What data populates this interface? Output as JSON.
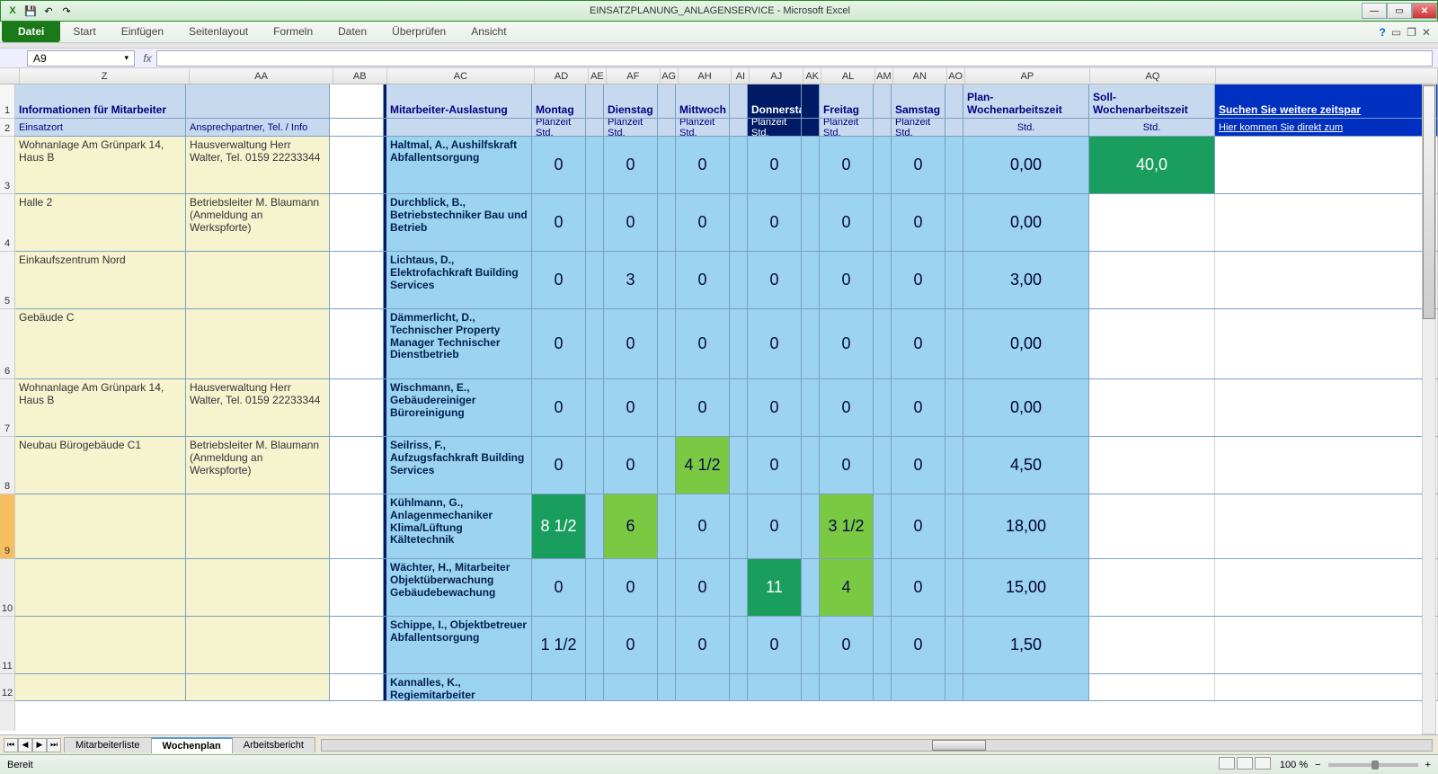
{
  "app": {
    "title": "EINSATZPLANUNG_ANLAGENSERVICE - Microsoft Excel"
  },
  "ribbon": {
    "file": "Datei",
    "tabs": [
      "Start",
      "Einfügen",
      "Seitenlayout",
      "Formeln",
      "Daten",
      "Überprüfen",
      "Ansicht"
    ]
  },
  "namebox": "A9",
  "columns": [
    "Z",
    "AA",
    "AB",
    "AC",
    "AD",
    "AE",
    "AF",
    "AG",
    "AH",
    "AI",
    "AJ",
    "AK",
    "AL",
    "AM",
    "AN",
    "AO",
    "AP",
    "AQ"
  ],
  "header1": {
    "z": "Informationen für Mitarbeiter",
    "ac": "Mitarbeiter-Auslastung",
    "days": [
      "Montag",
      "Dienstag",
      "Mittwoch",
      "Donnerstag",
      "Freitag",
      "Samstag"
    ],
    "ap": "Plan-Wochenarbeitszeit",
    "aq": "Soll-Wochenarbeitszeit",
    "ar": "Suchen Sie weitere zeitspar"
  },
  "header2": {
    "z": "Einsatzort",
    "aa": "Ansprechpartner, Tel. / Info",
    "pz": "Planzeit Std.",
    "std": "Std.",
    "ar": "Hier kommen Sie direkt zum"
  },
  "rows": [
    {
      "n": "3",
      "z": "Wohnanlage Am Grünpark 14, Haus B",
      "aa": "Hausverwaltung Herr Walter, Tel. 0159 22233344",
      "ac": "Haltmal, A., Aushilfskraft Abfallentsorgung",
      "d": [
        "0",
        "0",
        "0",
        "0",
        "0",
        "0"
      ],
      "ap": "0,00",
      "aq": "40,0",
      "hl": []
    },
    {
      "n": "4",
      "z": "Halle 2",
      "aa": "Betriebsleiter M. Blaumann (Anmeldung an Werkspforte)",
      "ac": "Durchblick, B., Betriebstechniker Bau und Betrieb",
      "d": [
        "0",
        "0",
        "0",
        "0",
        "0",
        "0"
      ],
      "ap": "0,00",
      "aq": "",
      "hl": []
    },
    {
      "n": "5",
      "z": "Einkaufszentrum Nord",
      "aa": "",
      "ac": "Lichtaus, D., Elektrofachkraft Building Services",
      "d": [
        "0",
        "3",
        "0",
        "0",
        "0",
        "0"
      ],
      "ap": "3,00",
      "aq": "",
      "hl": []
    },
    {
      "n": "6",
      "z": "Gebäude C",
      "aa": "",
      "ac": "Dämmerlicht, D., Technischer Property Manager Technischer Dienstbetrieb",
      "d": [
        "0",
        "0",
        "0",
        "0",
        "0",
        "0"
      ],
      "ap": "0,00",
      "aq": "",
      "hl": []
    },
    {
      "n": "7",
      "z": "Wohnanlage Am Grünpark 14, Haus B",
      "aa": "Hausverwaltung Herr Walter, Tel. 0159 22233344",
      "ac": "Wischmann, E., Gebäudereiniger Büroreinigung",
      "d": [
        "0",
        "0",
        "0",
        "0",
        "0",
        "0"
      ],
      "ap": "0,00",
      "aq": "",
      "hl": []
    },
    {
      "n": "8",
      "z": "Neubau Bürogebäude C1",
      "aa": "Betriebsleiter M. Blaumann (Anmeldung an Werkspforte)",
      "ac": "Seilriss, F., Aufzugsfachkraft Building Services",
      "d": [
        "0",
        "0",
        "4 1/2",
        "0",
        "0",
        "0"
      ],
      "ap": "4,50",
      "aq": "",
      "hl": [
        {
          "i": 2,
          "c": "green"
        }
      ]
    },
    {
      "n": "9",
      "z": "",
      "aa": "",
      "ac": "Kühlmann, G., Anlagenmechaniker Klima/Lüftung Kältetechnik",
      "d": [
        "8 1/2",
        "6",
        "0",
        "0",
        "3 1/2",
        "0"
      ],
      "ap": "18,00",
      "aq": "",
      "hl": [
        {
          "i": 0,
          "c": "dgreen"
        },
        {
          "i": 1,
          "c": "green"
        },
        {
          "i": 4,
          "c": "green"
        }
      ],
      "sel": true
    },
    {
      "n": "10",
      "z": "",
      "aa": "",
      "ac": "Wächter, H., Mitarbeiter Objektüberwachung Gebäudebewachung",
      "d": [
        "0",
        "0",
        "0",
        "11",
        "4",
        "0"
      ],
      "ap": "15,00",
      "aq": "",
      "hl": [
        {
          "i": 3,
          "c": "dgreen"
        },
        {
          "i": 4,
          "c": "green"
        }
      ]
    },
    {
      "n": "11",
      "z": "",
      "aa": "",
      "ac": "Schippe, I., Objektbetreuer Abfallentsorgung",
      "d": [
        "1 1/2",
        "0",
        "0",
        "0",
        "0",
        "0"
      ],
      "ap": "1,50",
      "aq": "",
      "hl": []
    },
    {
      "n": "12",
      "z": "",
      "aa": "",
      "ac": "Kannalles, K., Regiemitarbeiter",
      "d": [
        "",
        "",
        "",
        "",
        "",
        ""
      ],
      "ap": "",
      "aq": "",
      "hl": []
    }
  ],
  "sheets": {
    "list": [
      "Mitarbeiterliste",
      "Wochenplan",
      "Arbeitsbericht"
    ],
    "active": 1
  },
  "status": {
    "ready": "Bereit",
    "zoom": "100 %"
  }
}
